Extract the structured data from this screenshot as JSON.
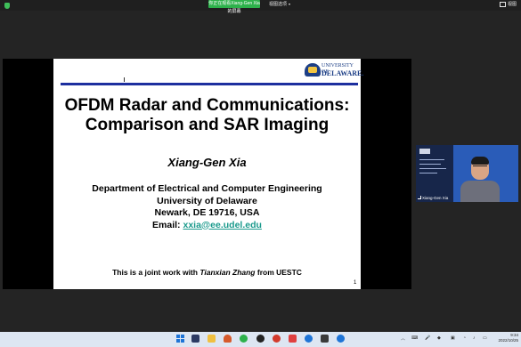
{
  "topbar": {
    "share_banner": "你正在观看Xiang-Gen Xia的屏幕",
    "view_options": "视图选项",
    "view_right": "视图",
    "shield_icon": "shield-check-icon"
  },
  "slide": {
    "logo_top": "UNIVERSITY OF",
    "logo_bottom": "DELAWARE.",
    "title_line1": "OFDM Radar and Communications:",
    "title_line2": "Comparison and SAR Imaging",
    "author": "Xiang-Gen Xia",
    "affiliation_line1": "Department of Electrical and Computer Engineering",
    "affiliation_line2": "University of Delaware",
    "affiliation_line3": "Newark, DE 19716, USA",
    "email_label": "Email: ",
    "email": "xxia@ee.udel.edu",
    "note_prefix": "This is a joint work with ",
    "note_name": "Tianxian Zhang",
    "note_suffix": " from UESTC",
    "page_number": "1"
  },
  "camera": {
    "name": "Xiang-Gen Xia"
  },
  "taskbar": {
    "icons": [
      "windows-start-icon",
      "file-explorer-icon",
      "store-icon",
      "folder-icon",
      "matlab-icon",
      "browser-icon",
      "chrome-icon",
      "qq-icon",
      "weibo-icon",
      "app-icon",
      "app-icon",
      "app-icon",
      "app-icon",
      "meeting-icon"
    ],
    "colors": {
      "blue": "#1e74d6",
      "orange": "#f0a020",
      "red": "#d33a2c",
      "green": "#2db14b"
    },
    "time": "9:34",
    "date": "2022/10/25"
  }
}
